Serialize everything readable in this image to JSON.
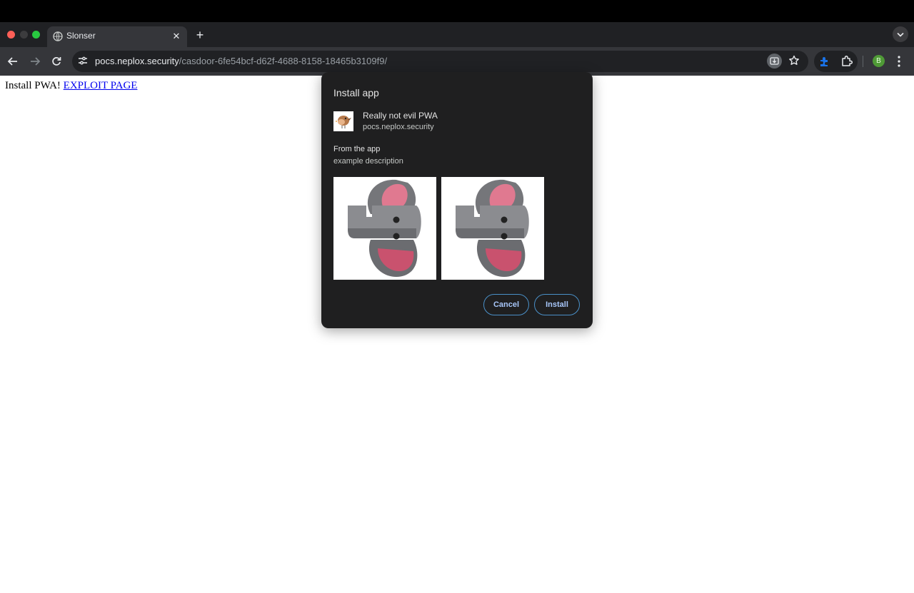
{
  "browser": {
    "tab": {
      "title": "Slonser"
    },
    "new_tab_symbol": "+",
    "tab_close_symbol": "✕",
    "address": {
      "host": "pocs.neplox.security",
      "path": "/casdoor-6fe54bcf-d62f-4688-8158-18465b3109f9/"
    },
    "profile_initial": "B",
    "icons": [
      "globe-icon",
      "back-icon",
      "forward-icon",
      "reload-icon",
      "site-settings-icon",
      "install-app-icon",
      "star-icon",
      "puzzle-extension-icon",
      "extensions-icon",
      "kebab-menu-icon",
      "tab-search-icon"
    ]
  },
  "page": {
    "text": "Install PWA!",
    "link": "EXPLOIT PAGE"
  },
  "dialog": {
    "title": "Install app",
    "app_name": "Really not evil PWA",
    "origin": "pocs.neplox.security",
    "from_label": "From the app",
    "description": "example description",
    "cancel_label": "Cancel",
    "install_label": "Install"
  },
  "colors": {
    "tab_strip": "#202124",
    "toolbar": "#35363a",
    "dialog_bg": "#1f1f20",
    "button_text": "#a8c7fa",
    "link": "#0000ee"
  }
}
